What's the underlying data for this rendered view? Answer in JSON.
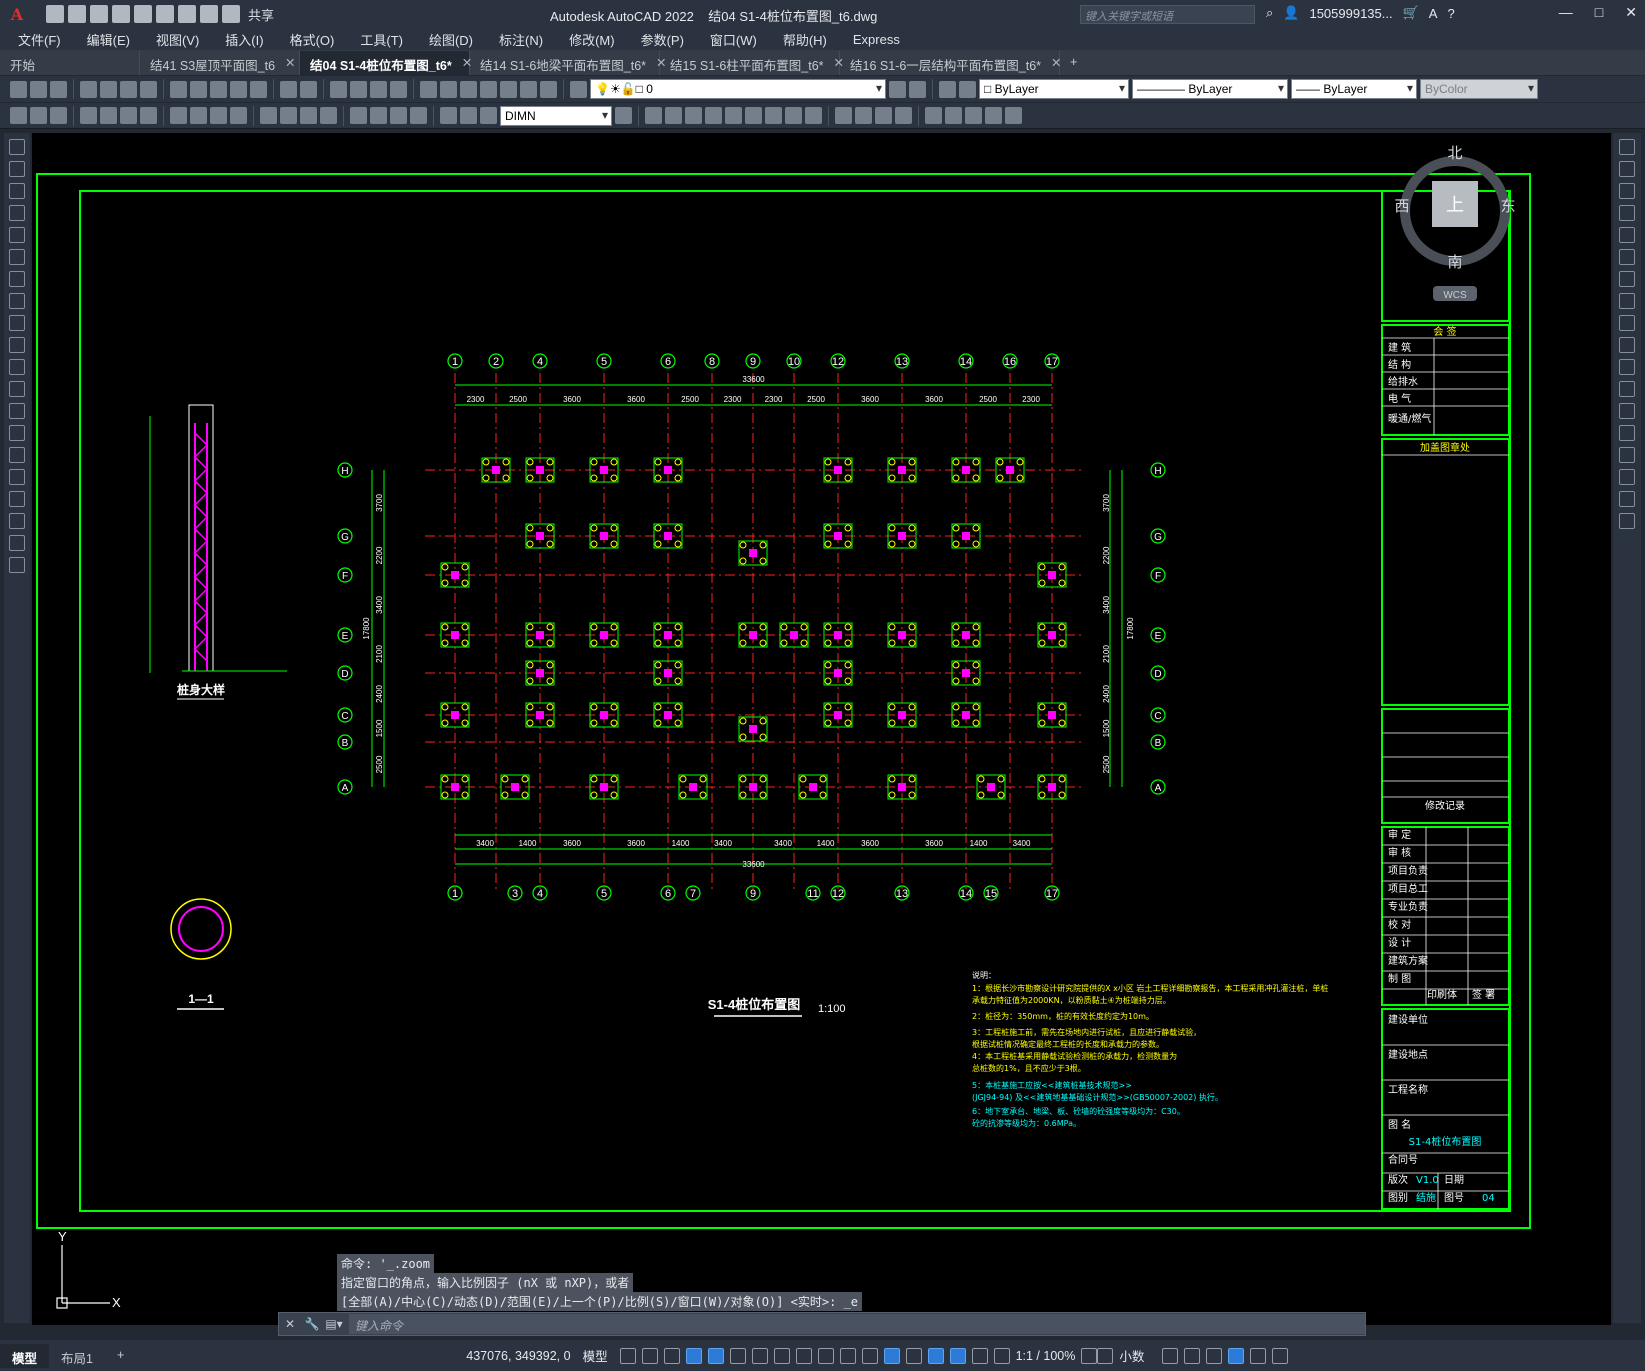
{
  "app": {
    "logo": "A",
    "title": "Autodesk AutoCAD 2022",
    "doc_title": "结04 S1-4桩位布置图_t6.dwg",
    "share_label": "共享",
    "search_placeholder": "键入关键字或短语",
    "user": "1505999135...",
    "window_controls": [
      "—",
      "□",
      "✕"
    ]
  },
  "menu": [
    "文件(F)",
    "编辑(E)",
    "视图(V)",
    "插入(I)",
    "格式(O)",
    "工具(T)",
    "绘图(D)",
    "标注(N)",
    "修改(M)",
    "参数(P)",
    "窗口(W)",
    "帮助(H)",
    "Express"
  ],
  "tabs": [
    {
      "label": "开始",
      "active": false,
      "closable": false
    },
    {
      "label": "结41 S3屋顶平面图_t6",
      "active": false,
      "closable": true
    },
    {
      "label": "结04 S1-4桩位布置图_t6*",
      "active": true,
      "closable": true
    },
    {
      "label": "结14 S1-6地梁平面布置图_t6*",
      "active": false,
      "closable": true
    },
    {
      "label": "结15 S1-6柱平面布置图_t6*",
      "active": false,
      "closable": true
    },
    {
      "label": "结16 S1-6一层结构平面布置图_t6*",
      "active": false,
      "closable": true
    }
  ],
  "new_tab_label": "+",
  "toolbar": {
    "layer_value": "0",
    "color_value": "ByLayer",
    "linetype_value": "ByLayer",
    "lineweight_value": "ByLayer",
    "plotstyle_value": "ByColor",
    "dimstyle_value": "DIMN"
  },
  "viewcube": {
    "north": "北",
    "south": "南",
    "east": "东",
    "west": "西",
    "top": "上",
    "wcs": "WCS"
  },
  "drawing": {
    "plan_title": "S1-4桩位布置图",
    "plan_scale": "1:100",
    "pile_detail_title": "桩身大样",
    "section_title": "1—1",
    "top_axes": [
      "1",
      "2",
      "4",
      "5",
      "6",
      "8",
      "9",
      "10",
      "12",
      "13",
      "14",
      "16",
      "17"
    ],
    "bottom_axes": [
      "1",
      "3",
      "4",
      "5",
      "6",
      "7",
      "9",
      "11",
      "12",
      "13",
      "14",
      "15",
      "17"
    ],
    "row_axes": [
      "H",
      "G",
      "F",
      "E",
      "D",
      "C",
      "B",
      "A"
    ],
    "top_dims": [
      "2300",
      "2500",
      "3600",
      "3600",
      "2500",
      "2300",
      "2300",
      "2500",
      "3600",
      "3600",
      "2500",
      "2300"
    ],
    "top_total": "33600",
    "bottom_dims": [
      "3400",
      "1400",
      "3600",
      "3600",
      "1400",
      "3400",
      "3400",
      "1400",
      "3600",
      "3600",
      "1400",
      "3400"
    ],
    "bottom_total": "33600",
    "side_dims": [
      "3700",
      "2200",
      "3400",
      "2100",
      "2400",
      "1500",
      "2500"
    ],
    "side_total": "17800",
    "notes_title": "说明：",
    "notes": [
      "1：根据长沙市勘察设计研究院提供的X x小区 岩土工程详细勘察报告，本工程采用冲孔灌注桩，单桩",
      "    承载力特征值为2000KN，以粉质黏土④为桩端持力层。",
      "2：桩径为：350mm，桩的有效长度约定为10m。",
      "3：工程桩施工前，需先在场地内进行试桩，且应进行静载试验，",
      "    根据试桩情况确定最终工程桩的长度和承载力的参数。",
      "4：本工程桩基采用静载试验检测桩的承载力，检测数量为",
      "    总桩数的1%，且不应少于3根。",
      "5：本桩基施工应按<<建筑桩基技术规范>>",
      "   (JGJ94-94) 及<<建筑地基基础设计规范>>(GB50007-2002) 执行。",
      "6：地下室承台、地梁、板、砼墙的砼强度等级均为：C30。",
      "    砼的抗渗等级均为：0.6MPa。"
    ],
    "titleblock": {
      "signoff": "会 签",
      "disciplines": [
        "建 筑",
        "结 构",
        "给排水",
        "电 气",
        "暖通/燃气"
      ],
      "stamp_area": "加盖图章处",
      "revision": "修改记录",
      "roles": [
        "审 定",
        "审 核",
        "项目负责",
        "项目总工",
        "专业负责",
        "校 对",
        "设 计",
        "建筑方案",
        "制 图"
      ],
      "print_label": "印刷体",
      "sign_label": "签 署",
      "client_label": "建设单位",
      "site_label": "建设地点",
      "project_label": "工程名称",
      "drawing_name_label": "图 名",
      "drawing_name": "S1-4桩位布置图",
      "contract_label": "合同号",
      "version_label": "版次",
      "version": "V1.0",
      "date_label": "日期",
      "category_label": "图别",
      "category": "结施",
      "number_label": "图号",
      "number": "04"
    }
  },
  "command": {
    "history": [
      "命令: '_.zoom",
      "指定窗口的角点，输入比例因子 (nX 或 nXP)，或者",
      "[全部(A)/中心(C)/动态(D)/范围(E)/上一个(P)/比例(S)/窗口(W)/对象(O)] <实时>: _e"
    ],
    "placeholder": "键入命令"
  },
  "status": {
    "layouts": [
      "模型",
      "布局1"
    ],
    "coords": "437076, 349392, 0",
    "space": "模型",
    "scale": "1:1 / 100%",
    "units": "小数"
  },
  "colors": {
    "frame": "#00ff00",
    "axis": "#ff2020",
    "text_yellow": "#ffff00",
    "cyan": "#00ffff",
    "pile": "#ff00ff",
    "white": "#ffffff"
  }
}
